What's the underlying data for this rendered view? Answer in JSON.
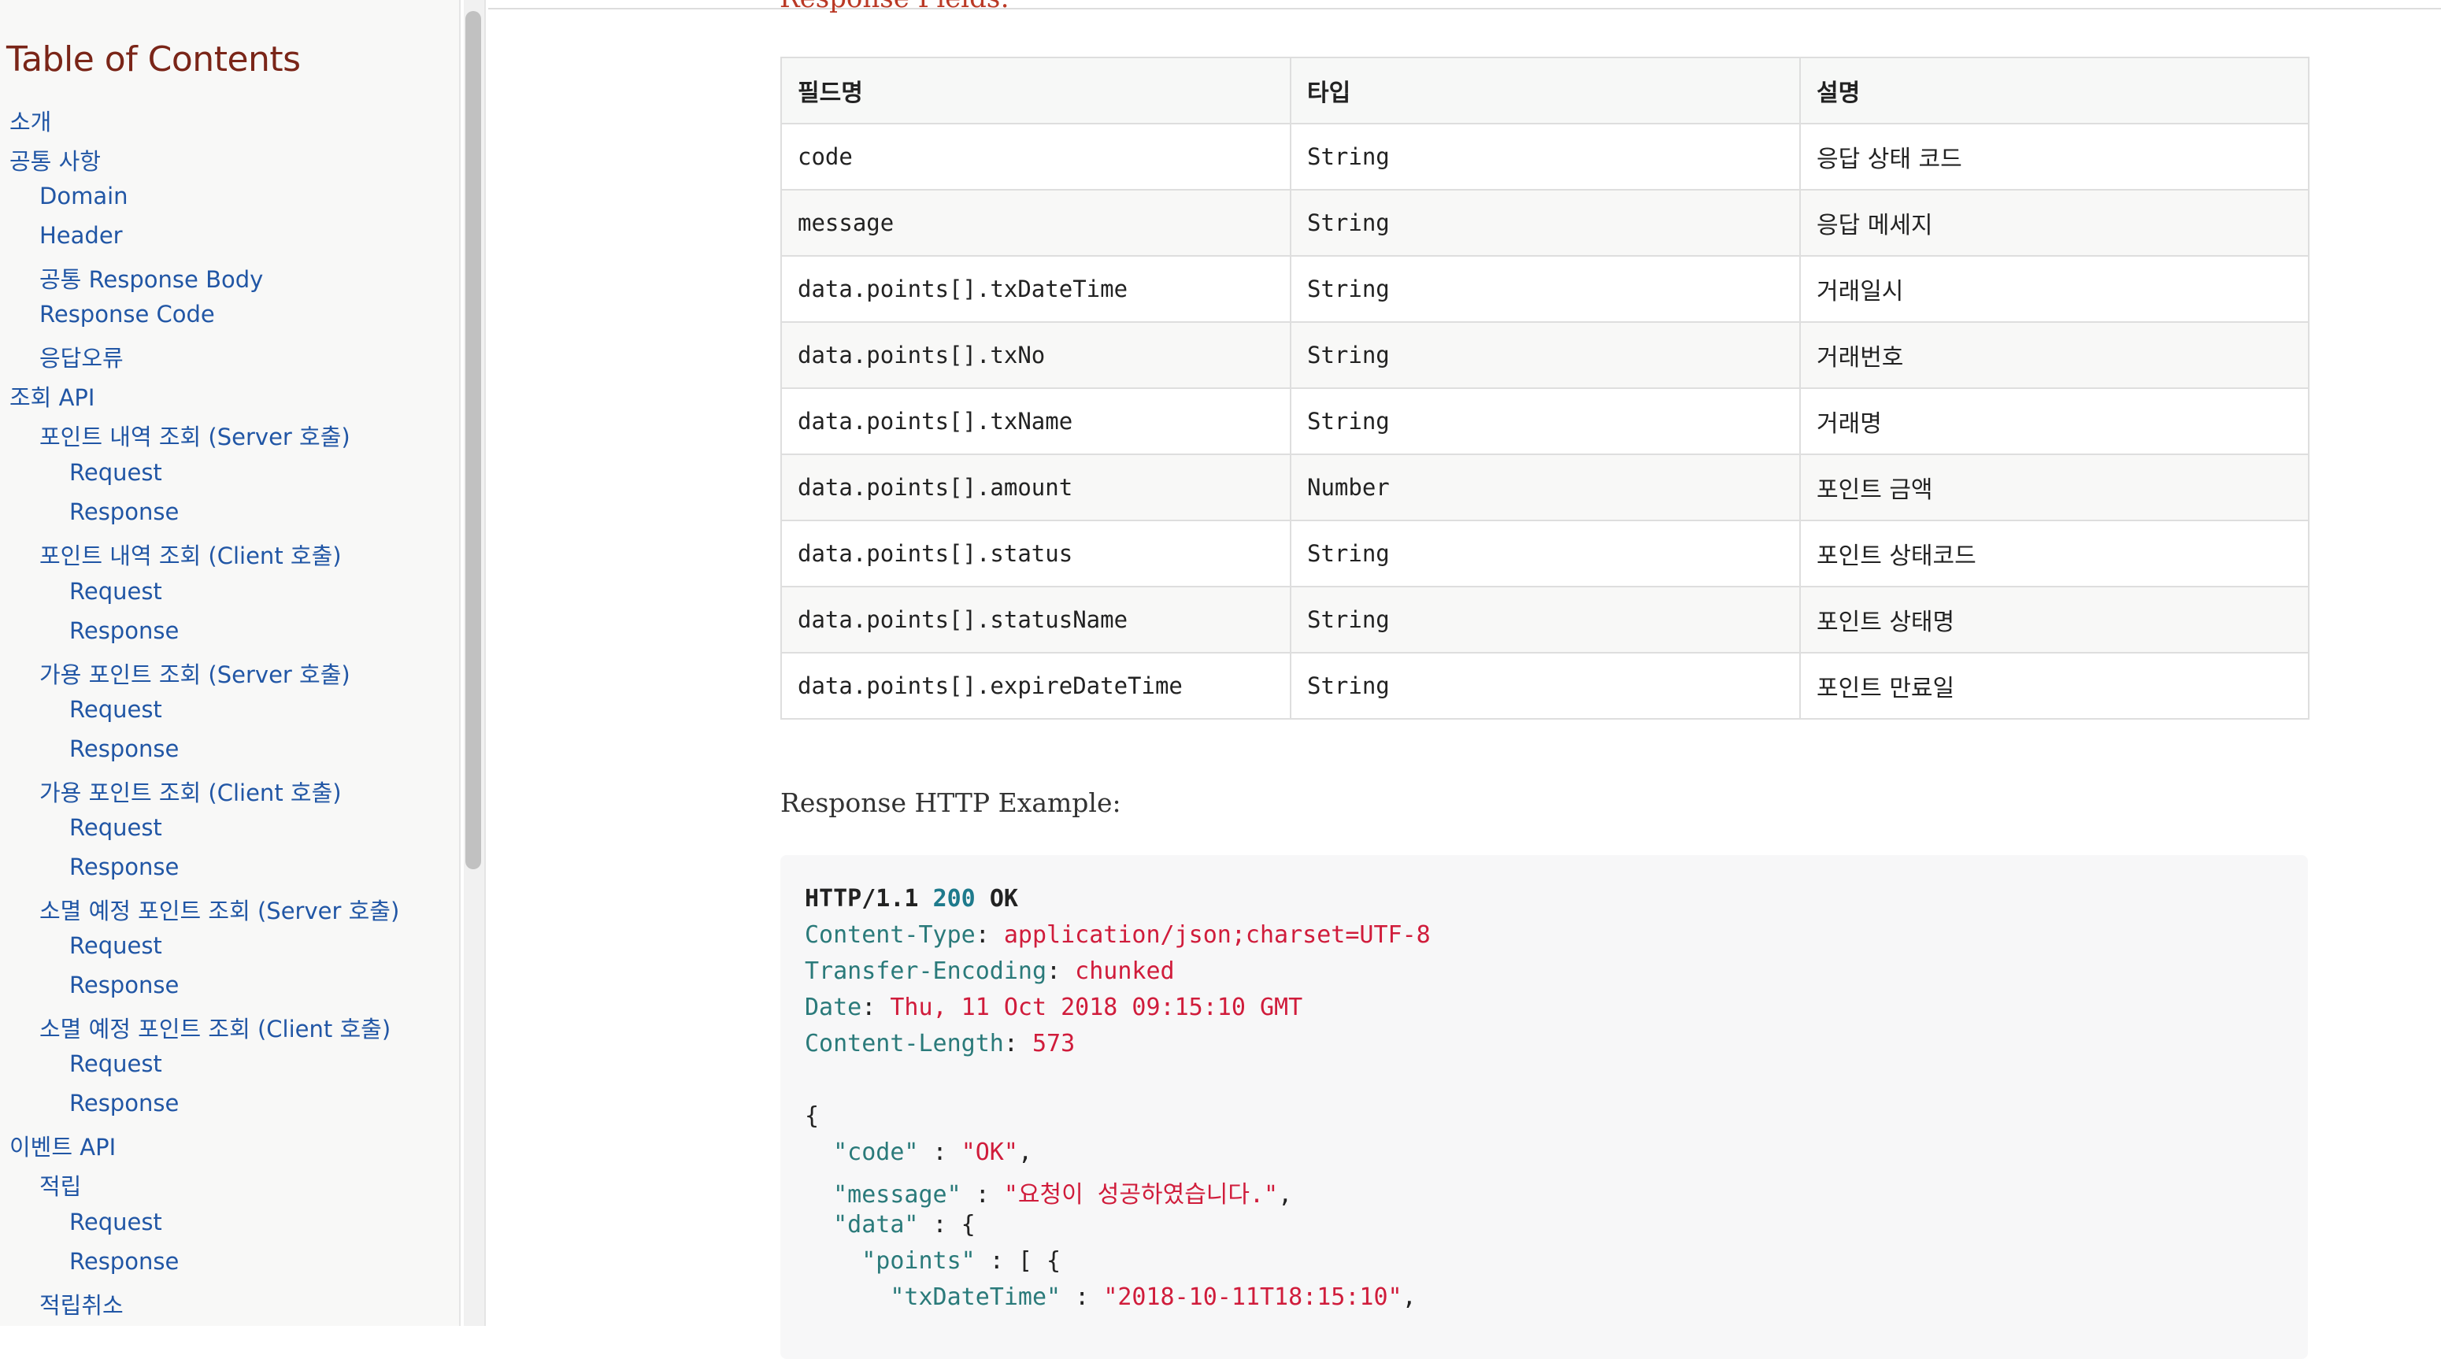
{
  "toc": {
    "title": "Table of Contents",
    "items": [
      {
        "label": "소개",
        "level": 1
      },
      {
        "label": "공통 사항",
        "level": 1
      },
      {
        "label": "Domain",
        "level": 2
      },
      {
        "label": "Header",
        "level": 2
      },
      {
        "label": "공통 Response Body",
        "level": 2
      },
      {
        "label": "Response Code",
        "level": 2
      },
      {
        "label": "응답오류",
        "level": 2
      },
      {
        "label": "조회 API",
        "level": 1
      },
      {
        "label": "포인트 내역 조회 (Server 호출)",
        "level": 2
      },
      {
        "label": "Request",
        "level": 3
      },
      {
        "label": "Response",
        "level": 3
      },
      {
        "label": "포인트 내역 조회 (Client 호출)",
        "level": 2
      },
      {
        "label": "Request",
        "level": 3
      },
      {
        "label": "Response",
        "level": 3
      },
      {
        "label": "가용 포인트 조회 (Server 호출)",
        "level": 2
      },
      {
        "label": "Request",
        "level": 3
      },
      {
        "label": "Response",
        "level": 3
      },
      {
        "label": "가용 포인트 조회 (Client 호출)",
        "level": 2
      },
      {
        "label": "Request",
        "level": 3
      },
      {
        "label": "Response",
        "level": 3
      },
      {
        "label": "소멸 예정 포인트 조회 (Server 호출)",
        "level": 2
      },
      {
        "label": "Request",
        "level": 3
      },
      {
        "label": "Response",
        "level": 3
      },
      {
        "label": "소멸 예정 포인트 조회 (Client 호출)",
        "level": 2
      },
      {
        "label": "Request",
        "level": 3
      },
      {
        "label": "Response",
        "level": 3
      },
      {
        "label": "이벤트 API",
        "level": 1
      },
      {
        "label": "적립",
        "level": 2
      },
      {
        "label": "Request",
        "level": 3
      },
      {
        "label": "Response",
        "level": 3
      },
      {
        "label": "적립취소",
        "level": 2
      }
    ]
  },
  "main": {
    "cut_heading": "Response Fields:",
    "table": {
      "headers": [
        "필드명",
        "타입",
        "설명"
      ],
      "rows": [
        [
          "code",
          "String",
          "응답 상태 코드"
        ],
        [
          "message",
          "String",
          "응답 메세지"
        ],
        [
          "data.points[].txDateTime",
          "String",
          "거래일시"
        ],
        [
          "data.points[].txNo",
          "String",
          "거래번호"
        ],
        [
          "data.points[].txName",
          "String",
          "거래명"
        ],
        [
          "data.points[].amount",
          "Number",
          "포인트 금액"
        ],
        [
          "data.points[].status",
          "String",
          "포인트 상태코드"
        ],
        [
          "data.points[].statusName",
          "String",
          "포인트 상태명"
        ],
        [
          "data.points[].expireDateTime",
          "String",
          "포인트 만료일"
        ]
      ]
    },
    "example_title": "Response HTTP Example:",
    "code": {
      "status_proto": "HTTP/1.1",
      "status_code": "200",
      "status_text": "OK",
      "headers": [
        {
          "name": "Content-Type",
          "value": "application/json;charset=UTF-8"
        },
        {
          "name": "Transfer-Encoding",
          "value": "chunked"
        },
        {
          "name": "Date",
          "value": "Thu, 11 Oct 2018 09:15:10 GMT"
        },
        {
          "name": "Content-Length",
          "value": "573"
        }
      ],
      "brace_open": "{",
      "code_key": "\"code\"",
      "code_val": "\"OK\"",
      "message_key": "\"message\"",
      "message_val": "\"요청이 성공하였습니다.\"",
      "data_key": "\"data\"",
      "data_rest": " : {",
      "points_key": "\"points\"",
      "points_rest": " : [ {",
      "txdt_key": "\"txDateTime\"",
      "txdt_val": "\"2018-10-11T18:15:10\""
    }
  },
  "colors": {
    "toc_title": "#7a2518",
    "toc_link": "#2156a5",
    "code_key": "#2a7a7a",
    "code_string": "#d01c3b",
    "code_number": "#1e7a8c"
  }
}
